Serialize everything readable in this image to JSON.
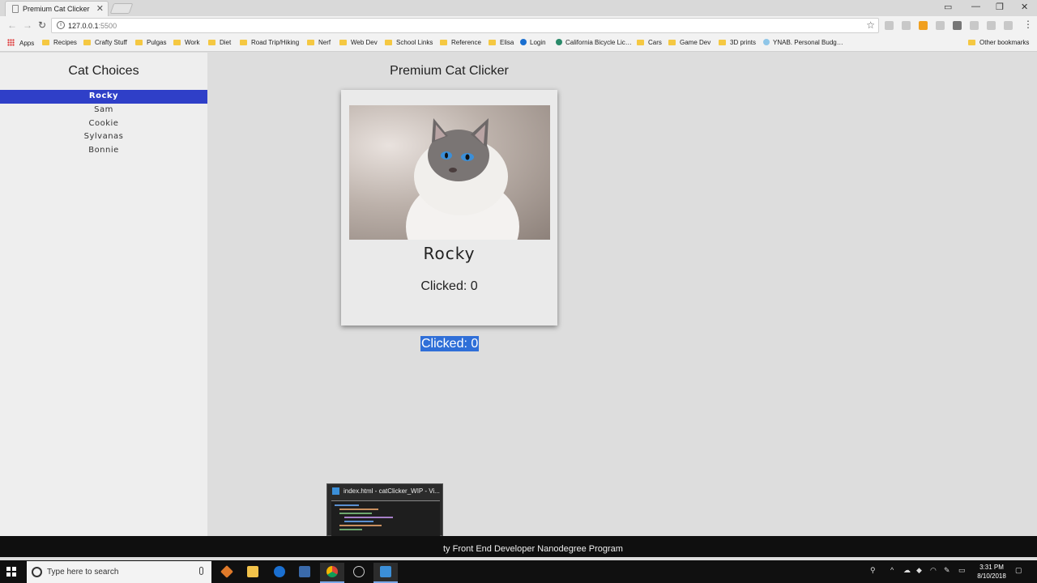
{
  "browser": {
    "tab_title": "Premium Cat Clicker",
    "url_host": "127.0.0.1",
    "url_port": ":5500",
    "bookmarks": [
      {
        "label": "Apps",
        "icon": "apps-grid-icon"
      },
      {
        "label": "Recipes",
        "icon": "folder-icon"
      },
      {
        "label": "Crafty Stuff",
        "icon": "folder-icon"
      },
      {
        "label": "Pulgas",
        "icon": "folder-icon"
      },
      {
        "label": "Work",
        "icon": "folder-icon"
      },
      {
        "label": "Diet",
        "icon": "folder-icon"
      },
      {
        "label": "Road Trip/Hiking",
        "icon": "folder-icon"
      },
      {
        "label": "Nerf",
        "icon": "folder-icon"
      },
      {
        "label": "Web Dev",
        "icon": "folder-icon"
      },
      {
        "label": "School Links",
        "icon": "folder-icon"
      },
      {
        "label": "Reference",
        "icon": "folder-icon"
      },
      {
        "label": "Elisa",
        "icon": "folder-icon"
      },
      {
        "label": "Login",
        "icon": "edge-icon"
      },
      {
        "label": "California Bicycle Lic…",
        "icon": "globe-icon"
      },
      {
        "label": "Cars",
        "icon": "folder-icon"
      },
      {
        "label": "Game Dev",
        "icon": "folder-icon"
      },
      {
        "label": "3D prints",
        "icon": "folder-icon"
      },
      {
        "label": "YNAB. Personal Budg…",
        "icon": "ynab-icon"
      }
    ],
    "other_bookmarks": "Other bookmarks"
  },
  "sidebar": {
    "title": "Cat Choices",
    "cats": [
      "Rocky",
      "Sam",
      "Cookie",
      "Sylvanas",
      "Bonnie"
    ],
    "selected": "Rocky"
  },
  "main": {
    "title": "Premium Cat Clicker",
    "cat_name": "Rocky",
    "clicked_card": "Clicked: 0",
    "clicked_outside": "Clicked: 0"
  },
  "taskbar": {
    "search_placeholder": "Type here to search",
    "preview_title": "index.html - catClicker_WIP - Vi...",
    "caption": "ty Front End Developer Nanodegree Program",
    "time": "3:31 PM",
    "date": "8/10/2018"
  },
  "colors": {
    "selected_item": "#2f3fc8",
    "selection_highlight": "#2f6fd8",
    "sidebar_bg": "#eeeeee",
    "page_bg": "#dddddd"
  }
}
